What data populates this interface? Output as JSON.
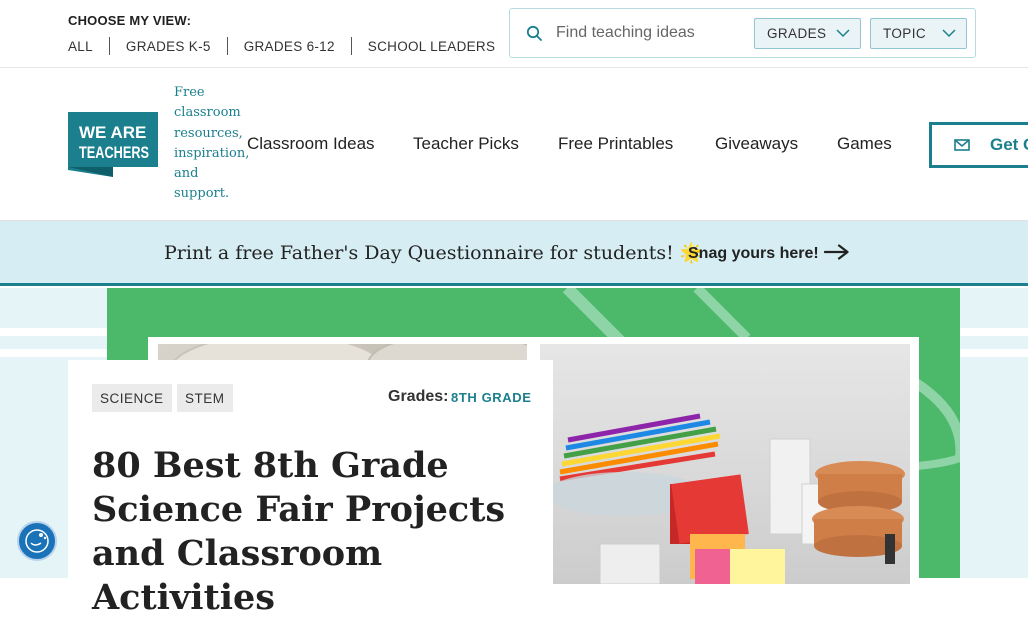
{
  "topbar": {
    "choose_label": "CHOOSE MY VIEW:",
    "views": [
      "ALL",
      "GRADES K-5",
      "GRADES 6-12",
      "SCHOOL LEADERS"
    ],
    "search": {
      "placeholder": "Find teaching ideas",
      "value": ""
    },
    "grades_dropdown": "GRADES",
    "topic_dropdown": "TOPIC"
  },
  "header": {
    "logo_text": [
      "WE ARE",
      "TEACHERS"
    ],
    "tagline": "Free classroom resources, inspiration, and support.",
    "nav": [
      "Classroom Ideas",
      "Teacher Picks",
      "Free Printables",
      "Giveaways",
      "Games"
    ],
    "cta": "Get Ou"
  },
  "banner": {
    "text": "Print a free Father's Day Questionnaire for students!",
    "emoji": "🌟",
    "link": "Snag yours here!"
  },
  "article": {
    "tags": [
      "SCIENCE",
      "STEM"
    ],
    "grades_label": "Grades:",
    "grade_value": "8TH GRADE",
    "title": "80 Best 8th Grade Science Fair Projects and Classroom Activities"
  },
  "colors": {
    "brand_teal": "#1b7f8e",
    "banner_bg": "#d6eef3",
    "hero_green": "#4cb86a",
    "accessibility_blue": "#1a73b8"
  }
}
